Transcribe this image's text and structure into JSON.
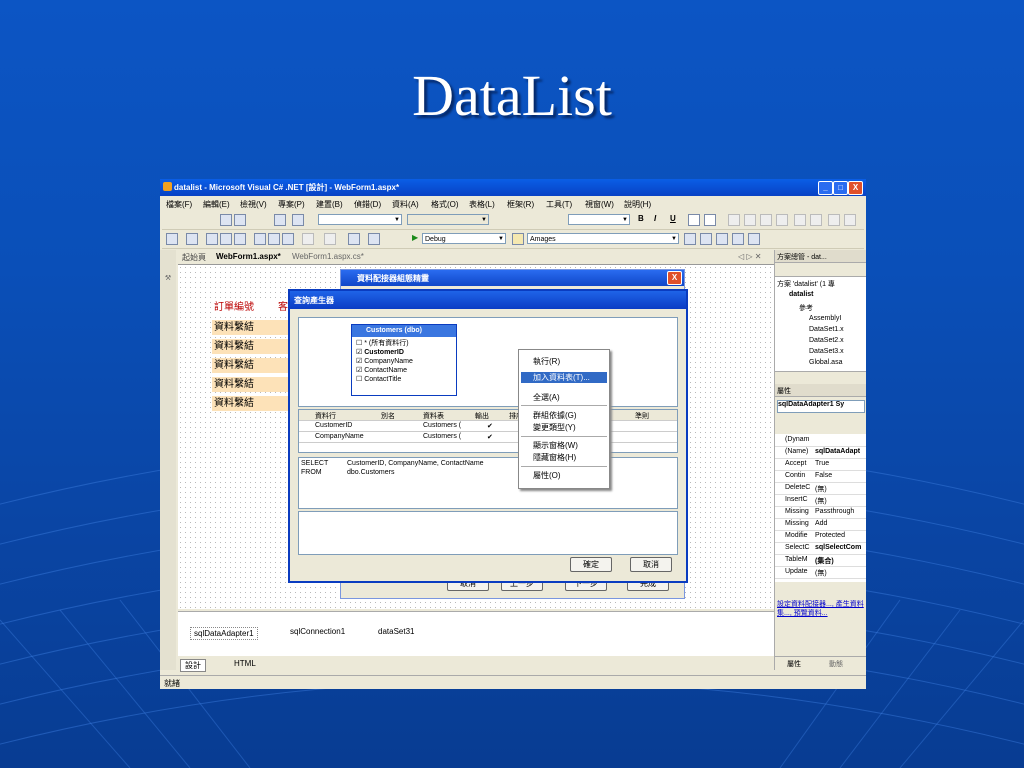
{
  "slide_title": "DataList",
  "window": {
    "title": "datalist - Microsoft Visual C# .NET [設計] - WebForm1.aspx*",
    "buttons": [
      "_",
      "□",
      "X"
    ]
  },
  "menu": [
    "檔案(F)",
    "編輯(E)",
    "檢視(V)",
    "專案(P)",
    "建置(B)",
    "偵錯(D)",
    "資料(A)",
    "格式(O)",
    "表格(L)",
    "框架(R)",
    "工具(T)",
    "視窗(W)",
    "說明(H)"
  ],
  "toolbar": {
    "format_b": "B",
    "format_i": "I",
    "format_u": "U",
    "debug_config": "Debug",
    "search_combo": "Amages"
  },
  "tabs": {
    "start": "起始頁",
    "active": "WebForm1.aspx*",
    "code": "WebForm1.aspx.cs*",
    "nav": "◁ ▷ ✕"
  },
  "design": {
    "header_label": "訂單編號",
    "header_label2": "客",
    "bind_labels": [
      "資料繫結",
      "資料繫結",
      "資料繫結",
      "資料繫結",
      "資料繫結"
    ]
  },
  "dialog_back": {
    "title": "資料配接器組態精靈"
  },
  "dialog": {
    "title": "查詢產生器",
    "table_box": {
      "title": "Customers (dbo)",
      "fields": [
        "* (所有資料行)",
        "CustomerID",
        "CompanyName",
        "ContactName",
        "ContactTitle"
      ],
      "checked": [
        false,
        true,
        true,
        true,
        false
      ]
    },
    "grid_headers": [
      "資料行",
      "別名",
      "資料表",
      "輸出",
      "排序",
      "準則"
    ],
    "grid_rows": [
      {
        "col": "CustomerID",
        "table": "Customers (",
        "out": "✔"
      },
      {
        "col": "CompanyName",
        "table": "Customers (",
        "out": "✔"
      }
    ],
    "sql": [
      "SELECT",
      "CustomerID, CompanyName, ContactName",
      "FROM",
      "dbo.Customers"
    ],
    "ok": "確定",
    "cancel": "取消",
    "back_buttons": [
      "取消",
      "上一步",
      "下一步",
      "完成"
    ]
  },
  "context_menu": {
    "items": [
      "執行(R)",
      "加入資料表(T)...",
      "全選(A)",
      "群組依據(G)",
      "變更類型(Y)",
      "顯示窗格(W)",
      "隱藏窗格(H)",
      "屬性(O)"
    ]
  },
  "tray": [
    "sqlDataAdapter1",
    "sqlConnection1",
    "dataSet31"
  ],
  "view_tabs": [
    "設計",
    "HTML"
  ],
  "status": "就緒",
  "solution_explorer": {
    "title": "方案總管 - dat...",
    "items": [
      "方案 'datalist' (1 專",
      "datalist",
      "參考",
      "AssemblyI",
      "DataSet1.x",
      "DataSet2.x",
      "DataSet3.x",
      "Global.asa"
    ]
  },
  "properties": {
    "title": "屬性",
    "object": "sqlDataAdapter1 Sy",
    "rows": [
      {
        "k": "(Dynam",
        "v": ""
      },
      {
        "k": "(Name)",
        "v": "sqlDataAdapt"
      },
      {
        "k": "Accept",
        "v": "True"
      },
      {
        "k": "Contin",
        "v": "False"
      },
      {
        "k": "DeleteC",
        "v": "(無)"
      },
      {
        "k": "InsertC",
        "v": "(無)"
      },
      {
        "k": "Missing",
        "v": "Passthrough"
      },
      {
        "k": "Missing",
        "v": "Add"
      },
      {
        "k": "Modifie",
        "v": "Protected"
      },
      {
        "k": "SelectC",
        "v": "sqlSelectCom"
      },
      {
        "k": "TableM",
        "v": "(集合)"
      },
      {
        "k": "Update",
        "v": "(無)"
      }
    ],
    "link_text": "設定資料配接器..., 產生資料集..., 預覽資料...",
    "bottom_tabs": [
      "屬性",
      "動態"
    ]
  }
}
